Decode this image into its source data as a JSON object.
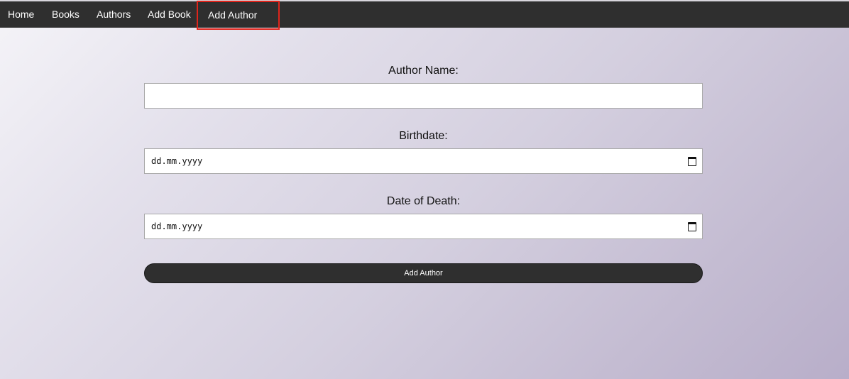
{
  "nav": {
    "items": [
      {
        "label": "Home"
      },
      {
        "label": "Books"
      },
      {
        "label": "Authors"
      },
      {
        "label": "Add Book"
      },
      {
        "label": "Add Author"
      }
    ],
    "active_highlight_color": "#e0241b",
    "background_color": "#2f2f2f"
  },
  "form": {
    "author_name": {
      "label": "Author Name:",
      "value": ""
    },
    "birthdate": {
      "label": "Birthdate:",
      "placeholder": "dd.mm.yyyy"
    },
    "date_of_death": {
      "label": "Date of Death:",
      "placeholder": "dd.mm.yyyy"
    },
    "submit_label": "Add Author"
  },
  "icons": {
    "calendar": "calendar-icon"
  }
}
